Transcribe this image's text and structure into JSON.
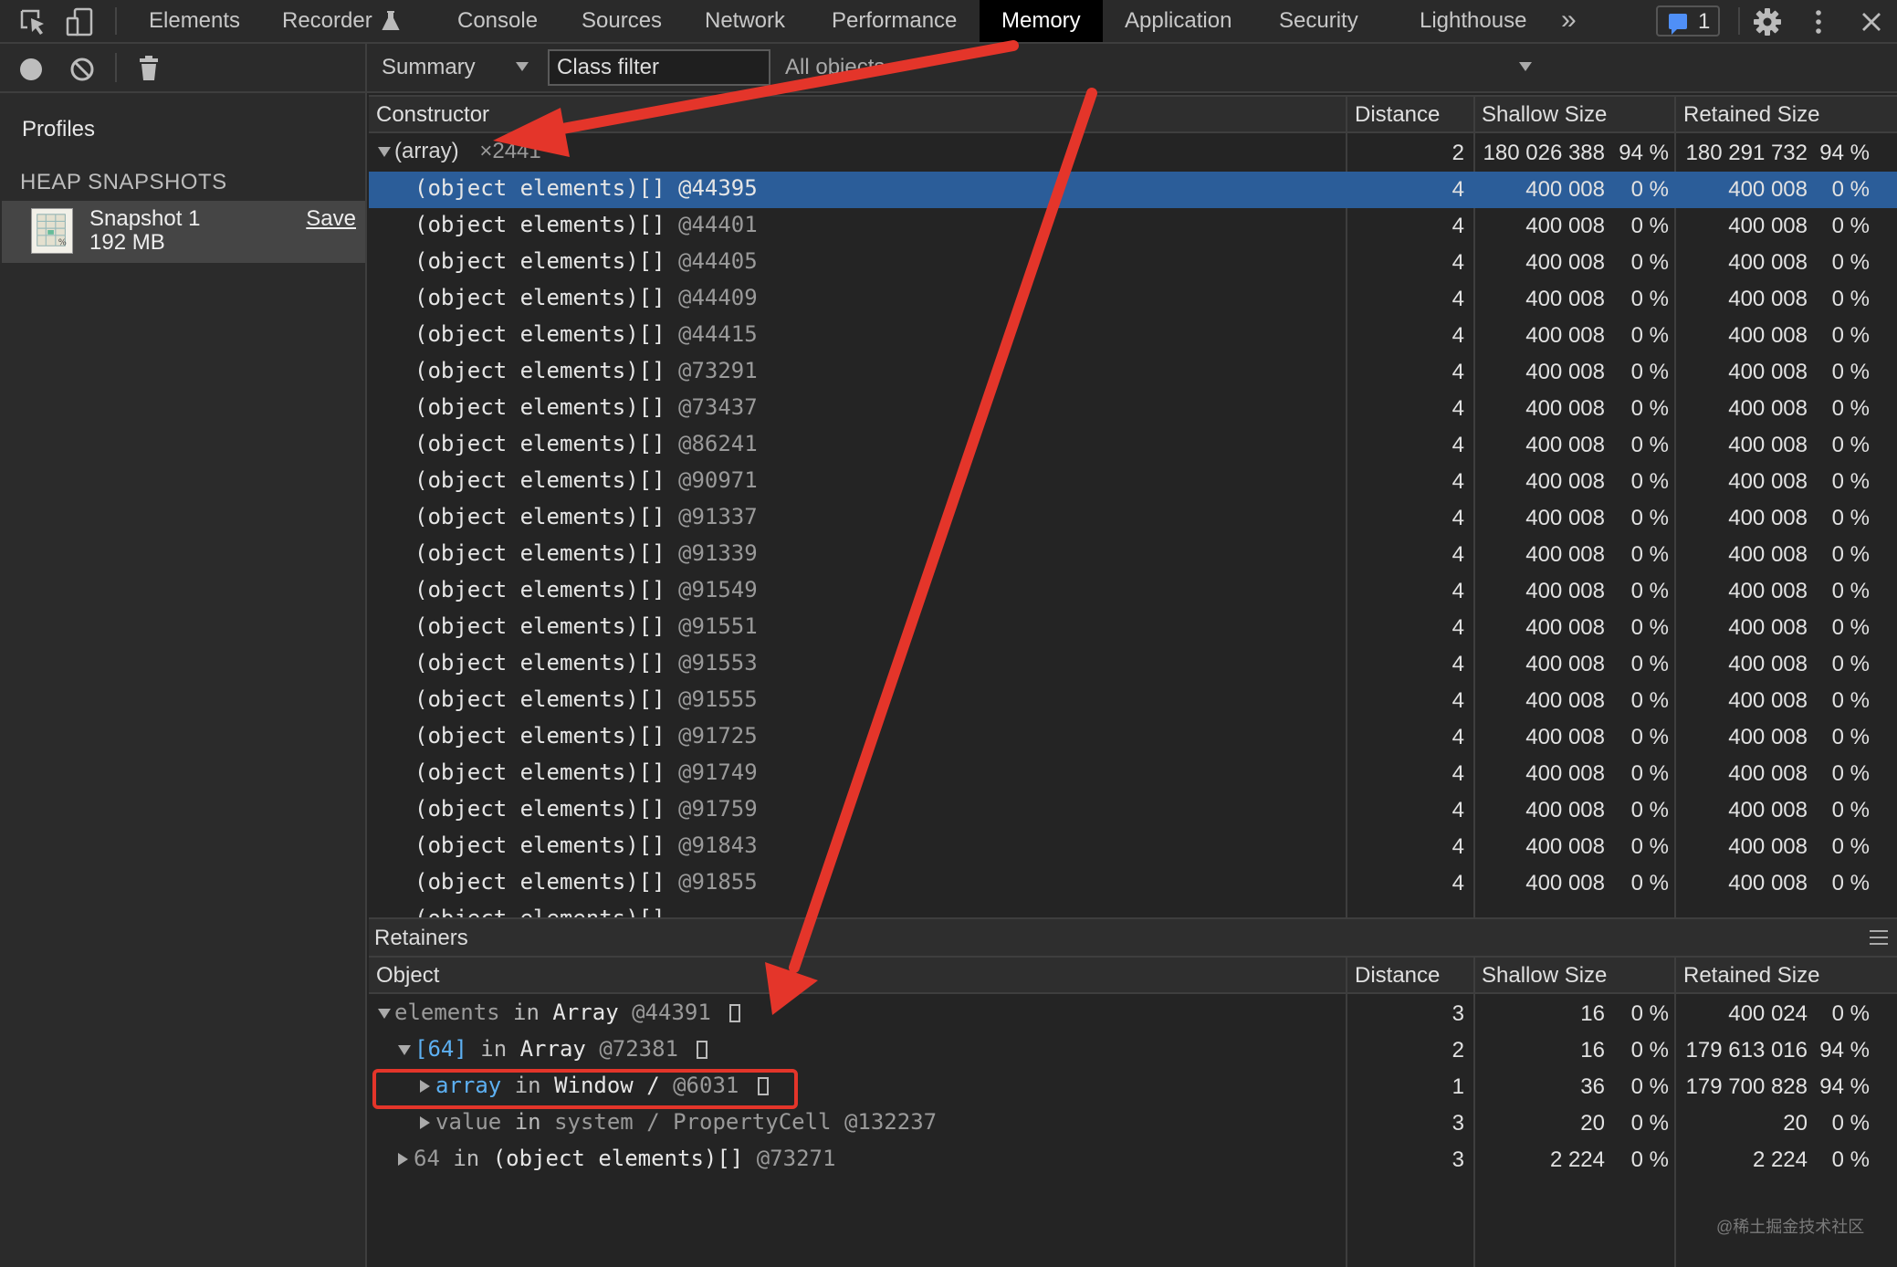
{
  "tabs": [
    {
      "label": "Elements"
    },
    {
      "label": "Recorder"
    },
    {
      "label": "Console"
    },
    {
      "label": "Sources"
    },
    {
      "label": "Network"
    },
    {
      "label": "Performance"
    },
    {
      "label": "Memory"
    },
    {
      "label": "Application"
    },
    {
      "label": "Security"
    },
    {
      "label": "Lighthouse"
    }
  ],
  "active_tab": "Memory",
  "more_tabs": "»",
  "issues_count": "1",
  "sidebar": {
    "profiles": "Profiles",
    "heap_snapshots": "HEAP SNAPSHOTS",
    "snapshot": {
      "name": "Snapshot 1",
      "size": "192 MB",
      "save": "Save"
    }
  },
  "toolbar": {
    "view": "Summary",
    "class_filter_placeholder": "Class filter",
    "objects": "All objects"
  },
  "constructor_table": {
    "headers": {
      "constructor": "Constructor",
      "distance": "Distance",
      "shallow": "Shallow Size",
      "retained": "Retained Size"
    },
    "group": {
      "name": "(array)",
      "count": "×2441",
      "distance": "2",
      "shallow": "180 026 388",
      "shallow_pct": "94 %",
      "retained": "180 291 732",
      "retained_pct": "94 %"
    },
    "rows": [
      {
        "name": "(object elements)[]",
        "id": "@44395",
        "distance": "4",
        "shallow": "400 008",
        "shallow_pct": "0 %",
        "retained": "400 008",
        "retained_pct": "0 %",
        "selected": true
      },
      {
        "name": "(object elements)[]",
        "id": "@44401",
        "distance": "4",
        "shallow": "400 008",
        "shallow_pct": "0 %",
        "retained": "400 008",
        "retained_pct": "0 %"
      },
      {
        "name": "(object elements)[]",
        "id": "@44405",
        "distance": "4",
        "shallow": "400 008",
        "shallow_pct": "0 %",
        "retained": "400 008",
        "retained_pct": "0 %"
      },
      {
        "name": "(object elements)[]",
        "id": "@44409",
        "distance": "4",
        "shallow": "400 008",
        "shallow_pct": "0 %",
        "retained": "400 008",
        "retained_pct": "0 %"
      },
      {
        "name": "(object elements)[]",
        "id": "@44415",
        "distance": "4",
        "shallow": "400 008",
        "shallow_pct": "0 %",
        "retained": "400 008",
        "retained_pct": "0 %"
      },
      {
        "name": "(object elements)[]",
        "id": "@73291",
        "distance": "4",
        "shallow": "400 008",
        "shallow_pct": "0 %",
        "retained": "400 008",
        "retained_pct": "0 %"
      },
      {
        "name": "(object elements)[]",
        "id": "@73437",
        "distance": "4",
        "shallow": "400 008",
        "shallow_pct": "0 %",
        "retained": "400 008",
        "retained_pct": "0 %"
      },
      {
        "name": "(object elements)[]",
        "id": "@86241",
        "distance": "4",
        "shallow": "400 008",
        "shallow_pct": "0 %",
        "retained": "400 008",
        "retained_pct": "0 %"
      },
      {
        "name": "(object elements)[]",
        "id": "@90971",
        "distance": "4",
        "shallow": "400 008",
        "shallow_pct": "0 %",
        "retained": "400 008",
        "retained_pct": "0 %"
      },
      {
        "name": "(object elements)[]",
        "id": "@91337",
        "distance": "4",
        "shallow": "400 008",
        "shallow_pct": "0 %",
        "retained": "400 008",
        "retained_pct": "0 %"
      },
      {
        "name": "(object elements)[]",
        "id": "@91339",
        "distance": "4",
        "shallow": "400 008",
        "shallow_pct": "0 %",
        "retained": "400 008",
        "retained_pct": "0 %"
      },
      {
        "name": "(object elements)[]",
        "id": "@91549",
        "distance": "4",
        "shallow": "400 008",
        "shallow_pct": "0 %",
        "retained": "400 008",
        "retained_pct": "0 %"
      },
      {
        "name": "(object elements)[]",
        "id": "@91551",
        "distance": "4",
        "shallow": "400 008",
        "shallow_pct": "0 %",
        "retained": "400 008",
        "retained_pct": "0 %"
      },
      {
        "name": "(object elements)[]",
        "id": "@91553",
        "distance": "4",
        "shallow": "400 008",
        "shallow_pct": "0 %",
        "retained": "400 008",
        "retained_pct": "0 %"
      },
      {
        "name": "(object elements)[]",
        "id": "@91555",
        "distance": "4",
        "shallow": "400 008",
        "shallow_pct": "0 %",
        "retained": "400 008",
        "retained_pct": "0 %"
      },
      {
        "name": "(object elements)[]",
        "id": "@91725",
        "distance": "4",
        "shallow": "400 008",
        "shallow_pct": "0 %",
        "retained": "400 008",
        "retained_pct": "0 %"
      },
      {
        "name": "(object elements)[]",
        "id": "@91749",
        "distance": "4",
        "shallow": "400 008",
        "shallow_pct": "0 %",
        "retained": "400 008",
        "retained_pct": "0 %"
      },
      {
        "name": "(object elements)[]",
        "id": "@91759",
        "distance": "4",
        "shallow": "400 008",
        "shallow_pct": "0 %",
        "retained": "400 008",
        "retained_pct": "0 %"
      },
      {
        "name": "(object elements)[]",
        "id": "@91843",
        "distance": "4",
        "shallow": "400 008",
        "shallow_pct": "0 %",
        "retained": "400 008",
        "retained_pct": "0 %"
      },
      {
        "name": "(object elements)[]",
        "id": "@91855",
        "distance": "4",
        "shallow": "400 008",
        "shallow_pct": "0 %",
        "retained": "400 008",
        "retained_pct": "0 %"
      }
    ]
  },
  "retainers": {
    "title": "Retainers",
    "headers": {
      "object": "Object",
      "distance": "Distance",
      "shallow": "Shallow Size",
      "retained": "Retained Size"
    },
    "rows": [
      {
        "prop": "elements",
        "kw": "in",
        "obj": "Array",
        "id": "@44391",
        "distance": "3",
        "shallow": "16",
        "shallow_pct": "0 %",
        "retained": "400 024",
        "retained_pct": "0 %"
      },
      {
        "prop": "[64]",
        "kw": "in",
        "obj": "Array",
        "id": "@72381",
        "distance": "2",
        "shallow": "16",
        "shallow_pct": "0 %",
        "retained": "179 613 016",
        "retained_pct": "94 %"
      },
      {
        "prop": "array",
        "kw": "in",
        "obj": "Window /",
        "id": "@6031",
        "distance": "1",
        "shallow": "36",
        "shallow_pct": "0 %",
        "retained": "179 700 828",
        "retained_pct": "94 %"
      },
      {
        "prop": "value",
        "kw": "in",
        "obj": "system / PropertyCell",
        "id": "@132237",
        "distance": "3",
        "shallow": "20",
        "shallow_pct": "0 %",
        "retained": "20",
        "retained_pct": "0 %"
      },
      {
        "prop": "64",
        "kw": "in",
        "obj": "(object elements)[]",
        "id": "@73271",
        "distance": "3",
        "shallow": "2 224",
        "shallow_pct": "0 %",
        "retained": "2 224",
        "retained_pct": "0 %"
      }
    ]
  },
  "watermark": "@稀土掘金技术社区",
  "colors": {
    "selected_row": "#2b5d99",
    "annotation": "#e4352a",
    "property": "#5db0f2"
  },
  "icons": [
    "inspect-icon",
    "device-toggle-icon",
    "recorder-flask-icon",
    "issues-chat-icon",
    "settings-gear-icon",
    "more-vertical-icon",
    "close-icon",
    "record-icon",
    "clear-icon",
    "trash-icon",
    "snapshot-file-icon",
    "retainers-menu-icon"
  ]
}
